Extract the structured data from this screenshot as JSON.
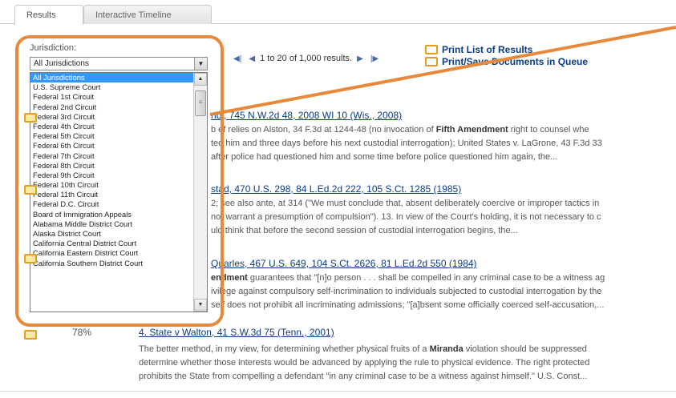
{
  "tabs": [
    {
      "label": "Results"
    },
    {
      "label": "Interactive Timeline"
    }
  ],
  "jurisdiction": {
    "label": "Jurisdiction:",
    "selected": "All Jurisdictions",
    "options": [
      "All Jurisdictions",
      "U.S. Supreme Court",
      "Federal 1st Circuit",
      "Federal 2nd Circuit",
      "Federal 3rd Circuit",
      "Federal 4th Circuit",
      "Federal 5th Circuit",
      "Federal 6th Circuit",
      "Federal 7th Circuit",
      "Federal 8th Circuit",
      "Federal 9th Circuit",
      "Federal 10th Circuit",
      "Federal 11th Circuit",
      "Federal D.C. Circuit",
      "Board of Immigration Appeals",
      "Alabama Middle District Court",
      "Alaska District Court",
      "California Central District Court",
      "California Eastern District Court",
      "California Southern District Court"
    ]
  },
  "pager": {
    "text": "1 to 20 of 1,000 results."
  },
  "print": {
    "list": "Print List of Results",
    "queue": "Print/Save Documents in Queue"
  },
  "results": [
    {
      "title": "nbi, 745 N.W.2d 48, 2008 WI 10 (Wis., 2008)",
      "lines": [
        [
          "b ef relies on Alston, 34 F.3d at 1244-48 (no invocation of ",
          "Fifth Amendment",
          " right to counsel whe"
        ],
        [
          "ted him and three days before his next custodial interrogation); United States v. LaGrone, 43 F.3d 33"
        ],
        [
          "after police had questioned him and some time before police questioned him again, the..."
        ]
      ]
    },
    {
      "title": "stad, 470 U.S. 298, 84 L.Ed.2d 222, 105 S.Ct. 1285 (1985)",
      "lines": [
        [
          "2; see also ante, at 314 (\"We must conclude that, absent deliberately coercive or improper tactics in"
        ],
        [
          " not warrant a presumption of compulsion\"). 13. In view of the Court's holding, it is not necessary to c"
        ],
        [
          "uld think that before the second session of custodial interrogation begins, the..."
        ]
      ]
    },
    {
      "title": "Quarles, 467 U.S. 649, 104 S.Ct. 2626, 81 L.Ed.2d 550 (1984)",
      "lines": [
        [
          "",
          "endment",
          " guarantees that \"[n]o person . . . shall be compelled in any criminal case to be a witness ag"
        ],
        [
          "ivilege against compulsory self-incrimination to individuals subjected to custodial interrogation by the"
        ],
        [
          "self does not prohibit all incriminating admissions; \"[a]bsent some officially coerced self-accusation,..."
        ]
      ]
    },
    {
      "score": "78%",
      "title": "4. State v Walton, 41 S.W.3d 75 (Tenn., 2001)",
      "lines": [
        [
          "The better method, in my view, for determining whether physical fruits of a ",
          "Miranda",
          " violation should be suppressed"
        ],
        [
          "determine whether those interests would be advanced by applying the rule to physical evidence. The right protected"
        ],
        [
          "prohibits the State from compelling a defendant \"in any criminal case to be a witness against himself.\" U.S. Const..."
        ]
      ]
    }
  ]
}
